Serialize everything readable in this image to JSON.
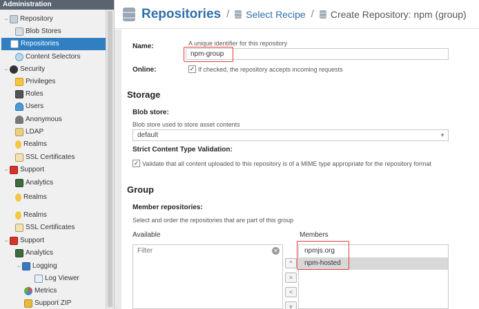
{
  "sidebar": {
    "header": "Administration",
    "items": [
      {
        "label": "Repository",
        "toggle": "−",
        "icon": "repository-icon"
      },
      {
        "label": "Blob Stores",
        "icon": "blob-stores-icon"
      },
      {
        "label": "Repositories",
        "icon": "repositories-icon",
        "selected": true
      },
      {
        "label": "Content Selectors",
        "icon": "content-selectors-icon"
      },
      {
        "label": "Security",
        "toggle": "−",
        "icon": "security-icon"
      },
      {
        "label": "Privileges",
        "icon": "privileges-icon"
      },
      {
        "label": "Roles",
        "icon": "roles-icon"
      },
      {
        "label": "Users",
        "icon": "users-icon"
      },
      {
        "label": "Anonymous",
        "icon": "anonymous-icon"
      },
      {
        "label": "LDAP",
        "icon": "ldap-icon"
      },
      {
        "label": "Realms",
        "icon": "realms-icon"
      },
      {
        "label": "SSL Certificates",
        "icon": "ssl-certificates-icon"
      },
      {
        "label": "Support",
        "toggle": "−",
        "icon": "support-icon"
      },
      {
        "label": "Analytics",
        "icon": "analytics-icon"
      },
      {
        "label": "Realms",
        "icon": "realms-icon"
      },
      {
        "label": "Realms",
        "icon": "realms-icon"
      },
      {
        "label": "SSL Certificates",
        "icon": "ssl-certificates-icon"
      },
      {
        "label": "Support",
        "toggle": "−",
        "icon": "support-icon"
      },
      {
        "label": "Analytics",
        "icon": "analytics-icon"
      },
      {
        "label": "Logging",
        "toggle": "−",
        "icon": "logging-icon"
      },
      {
        "label": "Log Viewer",
        "icon": "log-viewer-icon"
      },
      {
        "label": "Metrics",
        "icon": "metrics-icon"
      },
      {
        "label": "Support ZIP",
        "icon": "support-zip-icon"
      }
    ]
  },
  "header": {
    "title": "Repositories",
    "separator": "/",
    "crumb_recipe": "Select Recipe",
    "crumb_current": "Create Repository: npm (group)"
  },
  "form": {
    "name_label": "Name:",
    "name_help": "A unique identifier for this repository",
    "name_value": "npm-group",
    "online_label": "Online:",
    "online_checked": "✓",
    "online_help": "If checked, the repository accepts incoming requests",
    "storage_title": "Storage",
    "blob_label": "Blob store:",
    "blob_help": "Blob store used to store asset contents",
    "blob_value": "default",
    "strict_label": "Strict Content Type Validation:",
    "strict_checked": "✓",
    "strict_help": "Validate that all content uploaded to this repository is of a MIME type appropriate for the repository format",
    "group_title": "Group",
    "member_label": "Member repositories:",
    "member_help": "Select and order the repositories that are part of this group",
    "available_label": "Available",
    "filter_placeholder": "Filter",
    "clear_glyph": "✕",
    "members_label": "Members",
    "members": [
      "npmjs.org",
      "npm-hosted"
    ],
    "move_up": "^",
    "move_right": ">",
    "move_left": "<",
    "move_down": "v"
  },
  "colors": {
    "accent": "#2f6fa8",
    "selection": "#2f7fc1",
    "highlight": "#e23b3b"
  }
}
